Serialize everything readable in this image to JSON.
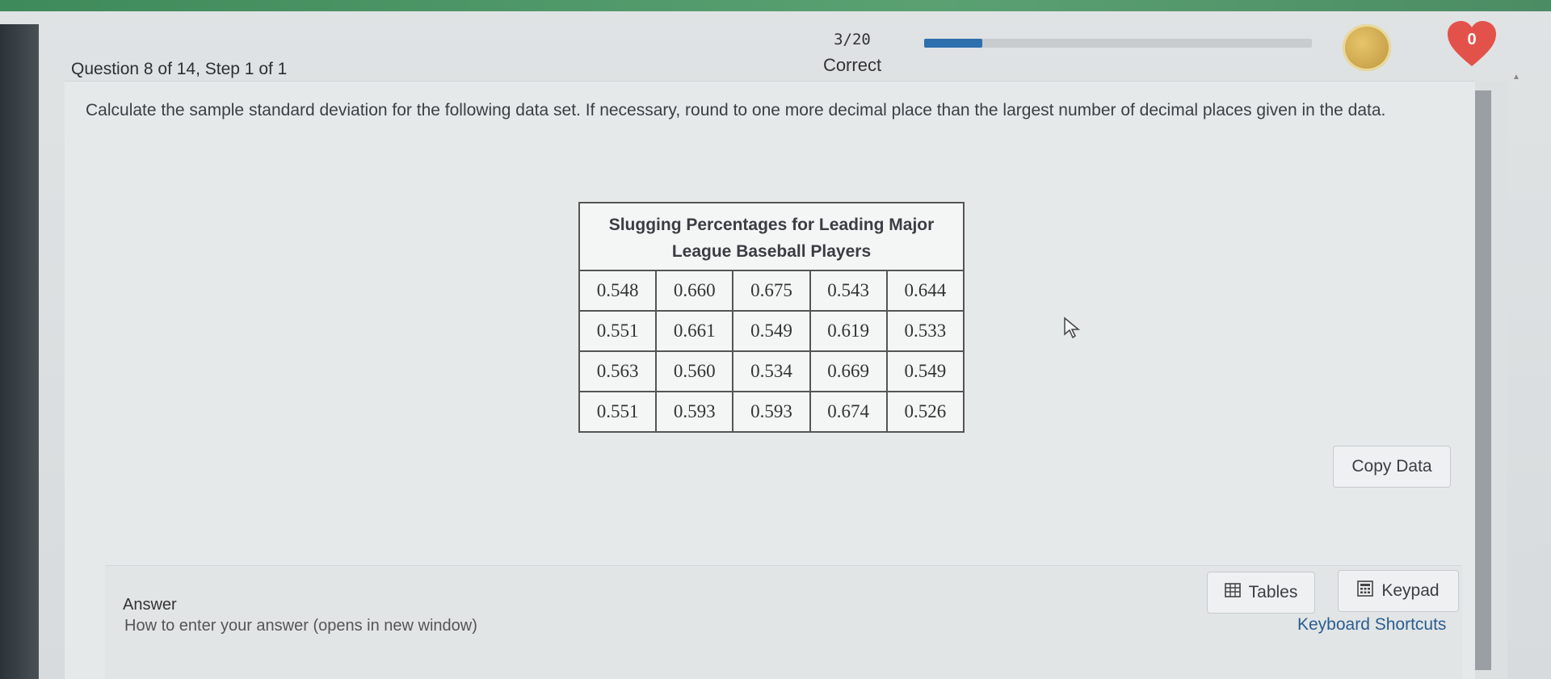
{
  "header": {
    "question_label": "Question 8 of 14, Step 1 of 1",
    "score_count": "3/20",
    "score_status": "Correct",
    "progress_fraction": 0.15,
    "heart_count": "0",
    "colors": {
      "progress": "#2e6fae",
      "heart": "#e3524a",
      "coin": "#d4b35a"
    }
  },
  "question": {
    "text": "Calculate the sample standard deviation for the following data set. If necessary, round to one more decimal place than the largest number of decimal places given in the data."
  },
  "table": {
    "title": "Slugging Percentages for Leading Major League Baseball Players",
    "rows": [
      [
        "0.548",
        "0.660",
        "0.675",
        "0.543",
        "0.644"
      ],
      [
        "0.551",
        "0.661",
        "0.549",
        "0.619",
        "0.533"
      ],
      [
        "0.563",
        "0.560",
        "0.534",
        "0.669",
        "0.549"
      ],
      [
        "0.551",
        "0.593",
        "0.593",
        "0.674",
        "0.526"
      ]
    ]
  },
  "actions": {
    "copy_data": "Copy Data",
    "tables": "Tables",
    "keypad": "Keypad",
    "keyboard_shortcuts": "Keyboard Shortcuts"
  },
  "answer": {
    "label": "Answer",
    "help_link": "How to enter your answer (opens in new window)"
  },
  "icons": {
    "tables": "table-grid-icon",
    "keypad": "calculator-icon",
    "coin": "coin-icon",
    "heart": "heart-icon",
    "cursor": "mouse-pointer-icon"
  }
}
